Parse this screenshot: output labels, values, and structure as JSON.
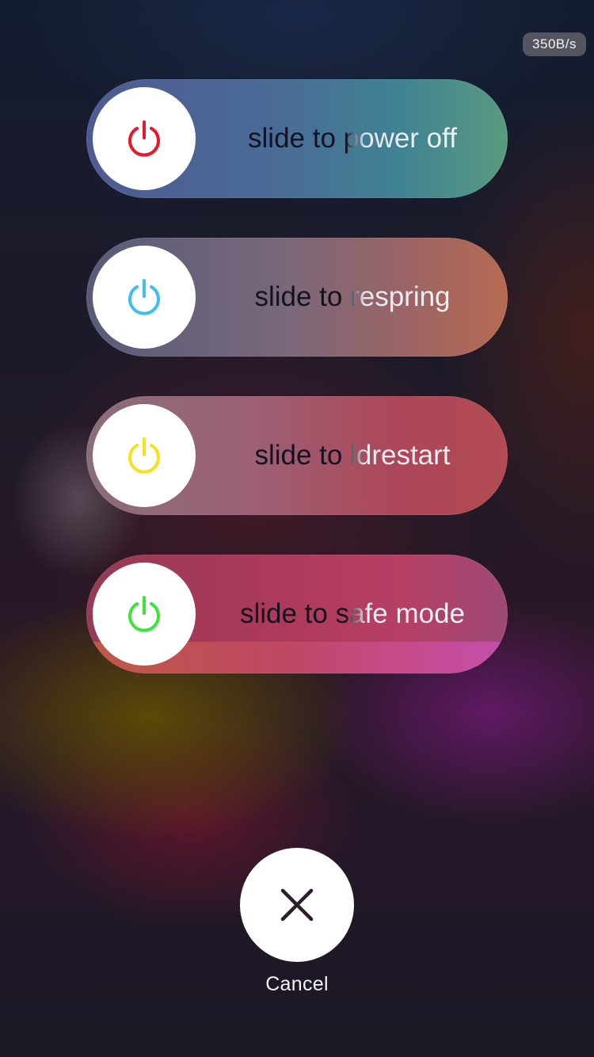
{
  "status": {
    "network_speed": "350B/s"
  },
  "sliders": [
    {
      "label": "slide to power off",
      "icon": "power-icon",
      "icon_color": "#e8192c"
    },
    {
      "label": "slide to respring",
      "icon": "power-icon",
      "icon_color": "#3dbff2"
    },
    {
      "label": "slide to ldrestart",
      "icon": "power-icon",
      "icon_color": "#f3e31c"
    },
    {
      "label": "slide to safe mode",
      "icon": "power-icon",
      "icon_color": "#3ee43a"
    }
  ],
  "cancel": {
    "label": "Cancel",
    "icon": "close-icon"
  }
}
